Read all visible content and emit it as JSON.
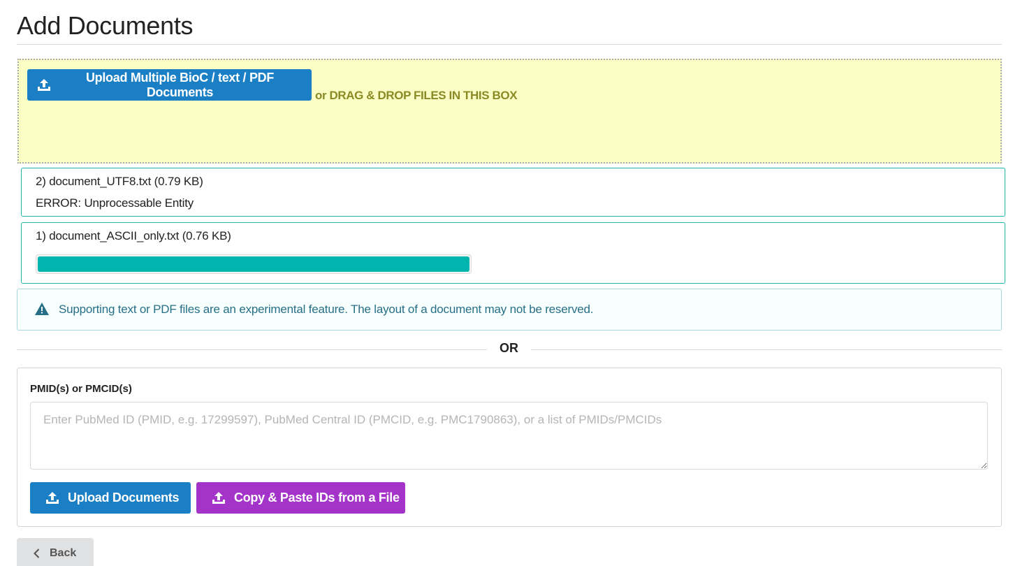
{
  "page": {
    "title": "Add Documents"
  },
  "dropzone": {
    "upload_button_label": "Upload Multiple BioC / text / PDF Documents",
    "drag_text": "or DRAG & DROP FILES IN THIS BOX",
    "background_color": "#fbfec4"
  },
  "files": [
    {
      "name": "2) document_UTF8.txt (0.79 KB)",
      "status": "ERROR: Unprocessable Entity"
    },
    {
      "name": "1) document_ASCII_only.txt (0.76 KB)",
      "progress": 1.0
    }
  ],
  "warning": {
    "icon": "warning-triangle-icon",
    "text": "Supporting text or PDF files are an experimental feature. The layout of a document may not be reserved."
  },
  "divider": {
    "label": "OR"
  },
  "pmid": {
    "label": "PMID(s) or PMCID(s)",
    "value": "",
    "placeholder": "Enter PubMed ID (PMID, e.g. 17299597), PubMed Central ID (PMCID, e.g. PMC1790863), or a list of PMIDs/PMCIDs"
  },
  "actions": {
    "upload_documents_label": "Upload Documents",
    "copy_paste_label": "Copy & Paste IDs from a File"
  },
  "back": {
    "label": "Back"
  },
  "colors": {
    "primary_blue": "#1b7fc5",
    "purple": "#a433c9",
    "teal": "#00b5ad",
    "warning_text": "#276f86"
  }
}
